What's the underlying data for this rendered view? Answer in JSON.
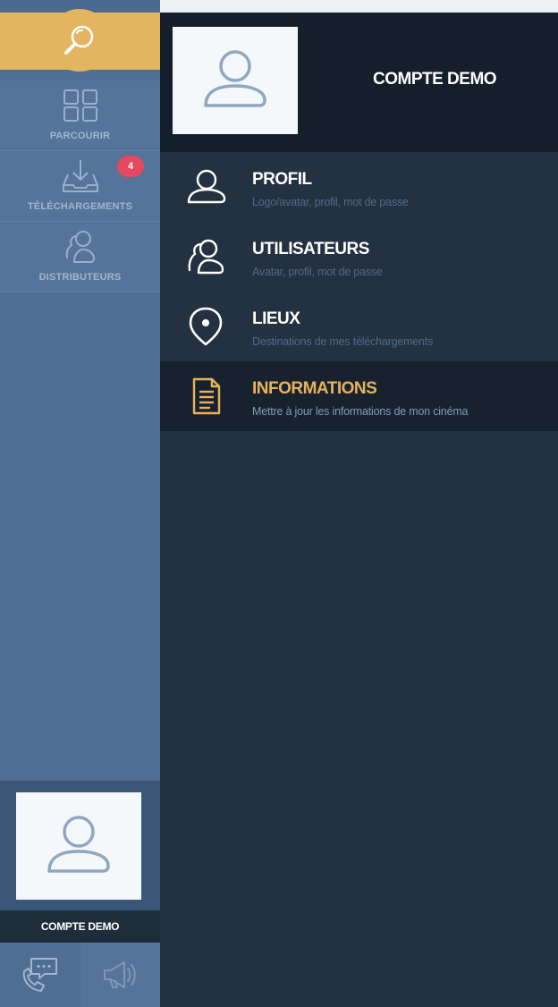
{
  "sidebar": {
    "nav": [
      {
        "label": "PARCOURIR",
        "icon": "grid-icon"
      },
      {
        "label": "TÉLÉCHARGEMENTS",
        "icon": "download-icon",
        "badge": "4"
      },
      {
        "label": "DISTRIBUTEURS",
        "icon": "distributors-icon"
      }
    ],
    "account_name": "COMPTE DEMO",
    "bottom": [
      {
        "icon": "support-chat-phone-icon"
      },
      {
        "icon": "megaphone-icon"
      }
    ]
  },
  "header": {
    "account_name": "COMPTE DEMO"
  },
  "menu": [
    {
      "title": "PROFIL",
      "subtitle": "Logo/avatar, profil, mot de passe",
      "icon": "user-icon"
    },
    {
      "title": "UTILISATEURS",
      "subtitle": "Avatar, profil, mot de passe",
      "icon": "users-icon"
    },
    {
      "title": "LIEUX",
      "subtitle": "Destinations de mes téléchargements",
      "icon": "location-pin-icon"
    },
    {
      "title": "INFORMATIONS",
      "subtitle": "Mettre à jour les informations de mon cinéma",
      "icon": "document-icon",
      "active": true
    }
  ],
  "colors": {
    "accent": "#e4b560",
    "sidebar": "#4e6e93",
    "panel": "#243140",
    "header": "#141f2b",
    "badge": "#e5495f"
  }
}
